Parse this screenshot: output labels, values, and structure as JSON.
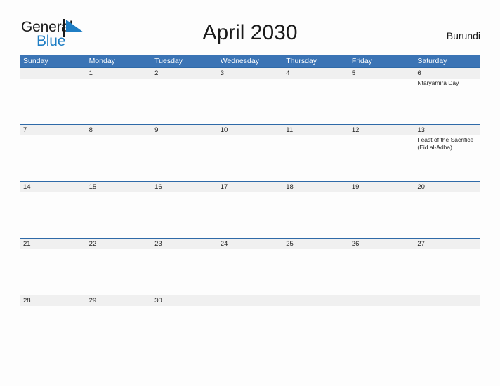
{
  "brand": {
    "name_part1": "General",
    "name_part2": "Blue",
    "mark": "triangle-flag-logo",
    "color_primary": "#1f7ec4",
    "color_text": "#1a1a1a"
  },
  "header": {
    "title": "April 2030",
    "country": "Burundi"
  },
  "calendar": {
    "accent_color": "#3b74b5",
    "band_color": "#f0f0f0",
    "weekdays": [
      "Sunday",
      "Monday",
      "Tuesday",
      "Wednesday",
      "Thursday",
      "Friday",
      "Saturday"
    ],
    "weeks": [
      [
        {
          "date": "",
          "event": ""
        },
        {
          "date": "1",
          "event": ""
        },
        {
          "date": "2",
          "event": ""
        },
        {
          "date": "3",
          "event": ""
        },
        {
          "date": "4",
          "event": ""
        },
        {
          "date": "5",
          "event": ""
        },
        {
          "date": "6",
          "event": "Ntaryamira Day"
        }
      ],
      [
        {
          "date": "7",
          "event": ""
        },
        {
          "date": "8",
          "event": ""
        },
        {
          "date": "9",
          "event": ""
        },
        {
          "date": "10",
          "event": ""
        },
        {
          "date": "11",
          "event": ""
        },
        {
          "date": "12",
          "event": ""
        },
        {
          "date": "13",
          "event": "Feast of the Sacrifice (Eid al-Adha)"
        }
      ],
      [
        {
          "date": "14",
          "event": ""
        },
        {
          "date": "15",
          "event": ""
        },
        {
          "date": "16",
          "event": ""
        },
        {
          "date": "17",
          "event": ""
        },
        {
          "date": "18",
          "event": ""
        },
        {
          "date": "19",
          "event": ""
        },
        {
          "date": "20",
          "event": ""
        }
      ],
      [
        {
          "date": "21",
          "event": ""
        },
        {
          "date": "22",
          "event": ""
        },
        {
          "date": "23",
          "event": ""
        },
        {
          "date": "24",
          "event": ""
        },
        {
          "date": "25",
          "event": ""
        },
        {
          "date": "26",
          "event": ""
        },
        {
          "date": "27",
          "event": ""
        }
      ],
      [
        {
          "date": "28",
          "event": ""
        },
        {
          "date": "29",
          "event": ""
        },
        {
          "date": "30",
          "event": ""
        },
        {
          "date": "",
          "event": ""
        },
        {
          "date": "",
          "event": ""
        },
        {
          "date": "",
          "event": ""
        },
        {
          "date": "",
          "event": ""
        }
      ]
    ]
  }
}
